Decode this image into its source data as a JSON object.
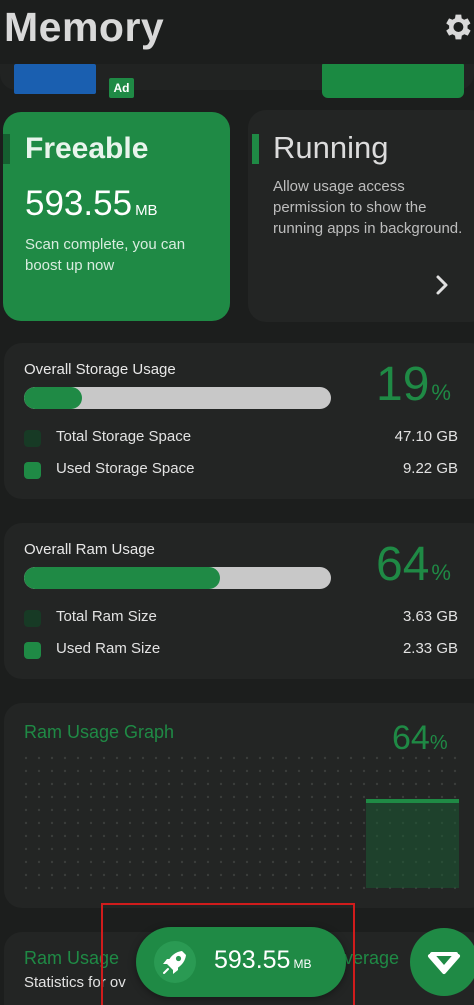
{
  "header": {
    "title": "Memory",
    "settings_icon": "gear-icon"
  },
  "ad": {
    "badge": "Ad"
  },
  "freeable": {
    "title": "Freeable",
    "value": "593.55",
    "unit": "MB",
    "subtitle": "Scan complete, you can boost up now"
  },
  "running": {
    "title": "Running",
    "description": "Allow usage access permission to show the running apps in background.",
    "chevron_icon": "chevron-right-icon"
  },
  "storage": {
    "title": "Overall Storage Usage",
    "percent": "19",
    "percent_value": 19,
    "percent_sign": "%",
    "rows": [
      {
        "label": "Total Storage Space",
        "value": "47.10 GB"
      },
      {
        "label": "Used Storage Space",
        "value": "9.22 GB"
      }
    ]
  },
  "ram": {
    "title": "Overall Ram Usage",
    "percent": "64",
    "percent_value": 64,
    "percent_sign": "%",
    "rows": [
      {
        "label": "Total Ram Size",
        "value": "3.63 GB"
      },
      {
        "label": "Used Ram Size",
        "value": "2.33 GB"
      }
    ]
  },
  "graph": {
    "title": "Ram Usage Graph",
    "percent": "64",
    "percent_sign": "%"
  },
  "stats": {
    "title": "Ram Usage",
    "subtitle": "Statistics for ov",
    "right_title": "verage"
  },
  "boost": {
    "value": "593.55",
    "unit": "MB",
    "icon": "rocket-icon"
  },
  "vip_icon": "diamond-icon",
  "colors": {
    "accent": "#1f8a45",
    "background": "#1c1e1d",
    "card": "#232524",
    "highlight": "#d01c1c"
  }
}
